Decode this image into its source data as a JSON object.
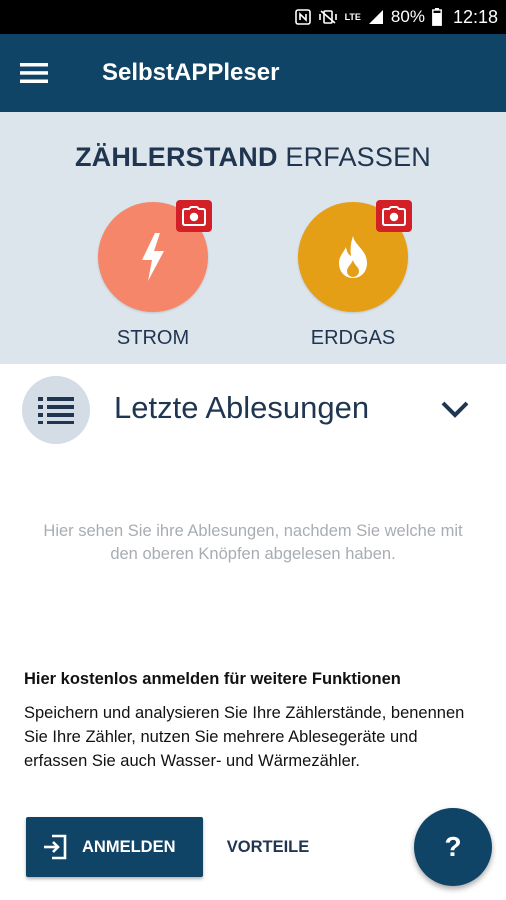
{
  "status_bar": {
    "battery_percent": "80%",
    "time": "12:18",
    "network_label": "LTE",
    "icons": [
      "nfc-icon",
      "vibrate-off-icon",
      "signal-icon",
      "battery-icon"
    ]
  },
  "app_bar": {
    "title": "SelbstAPPleser",
    "menu_icon": "hamburger-menu-icon",
    "background": "#0f4467"
  },
  "capture": {
    "heading_bold": "ZÄHLERSTAND",
    "heading_regular": "ERFASSEN",
    "meters": [
      {
        "label": "STROM",
        "icon": "lightning-icon",
        "color": "#f5866a"
      },
      {
        "label": "ERDGAS",
        "icon": "flame-icon",
        "color": "#e49f16"
      }
    ],
    "badge_icon": "camera-icon",
    "badge_color": "#d32027"
  },
  "readings": {
    "title": "Letzte Ablesungen",
    "list_icon": "list-icon",
    "toggle_icon": "chevron-down-icon",
    "empty_text": "Hier sehen Sie ihre Ablesungen, nachdem Sie welche mit den oberen Knöpfen abgelesen haben."
  },
  "register": {
    "title": "Hier kostenlos anmelden für weitere Funktionen",
    "text": "Speichern und analysieren Sie Ihre Zählerstände, benennen Sie Ihre Zähler, nutzen Sie mehrere Ablesegeräte und erfassen Sie auch Wasser- und Wärmezähler.",
    "login_button": "ANMELDEN",
    "login_icon": "login-icon",
    "benefits_button": "VORTEILE"
  },
  "help_fab": {
    "label": "?"
  }
}
